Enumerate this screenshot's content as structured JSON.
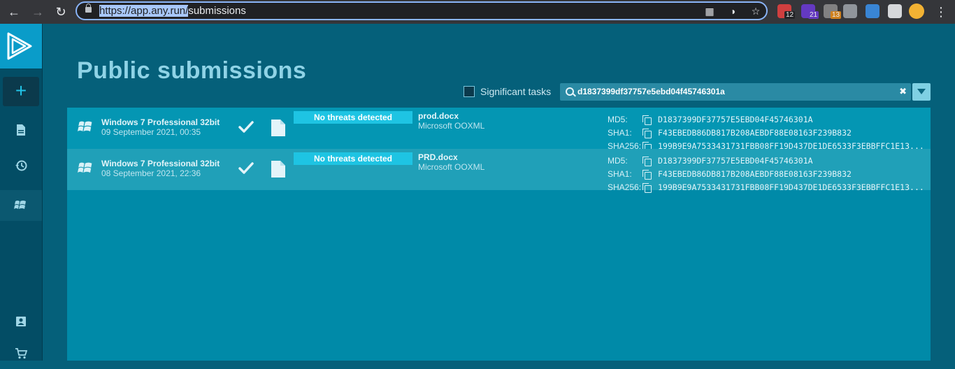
{
  "browser": {
    "url_selected": "https://app.any.run/",
    "url_rest": "submissions",
    "extensions": [
      {
        "name": "ext-red-icon",
        "badge": "12",
        "color": "#e04040",
        "badge_color": "#202124"
      },
      {
        "name": "ext-cap-icon",
        "badge": "21",
        "color": "#6a3ad0",
        "badge_color": "#6a3ad0"
      },
      {
        "name": "ext-grey-icon",
        "badge": "13",
        "color": "#8a8a8a",
        "badge_color": "#e08a1c"
      },
      {
        "name": "ext-feather-icon",
        "badge": "",
        "color": "#9aa0a6",
        "badge_color": ""
      },
      {
        "name": "ext-pin-icon",
        "badge": "",
        "color": "#3a8ee6",
        "badge_color": ""
      },
      {
        "name": "ext-puzzle-icon",
        "badge": "",
        "color": "#e8eaed",
        "badge_color": ""
      }
    ]
  },
  "page": {
    "title": "Public submissions",
    "significant_label": "Significant tasks",
    "search_value": "d1837399df37757e5ebd04f45746301a"
  },
  "tasks": [
    {
      "os": "Windows 7 Professional 32bit",
      "date": "09 September 2021, 00:35",
      "verdict": "No threats detected",
      "file_name": "prod.docx",
      "file_type": "Microsoft OOXML",
      "md5_label": "MD5:",
      "md5": "D1837399DF37757E5EBD04F45746301A",
      "sha1_label": "SHA1:",
      "sha1": "F43EBEDB86DB817B208AEBDF88E08163F239B832",
      "sha256_label": "SHA256:",
      "sha256": "199B9E9A7533431731FBB08FF19D437DE1DE6533F3EBBFFC1E13..."
    },
    {
      "os": "Windows 7 Professional 32bit",
      "date": "08 September 2021, 22:36",
      "verdict": "No threats detected",
      "file_name": "PRD.docx",
      "file_type": "Microsoft OOXML",
      "md5_label": "MD5:",
      "md5": "D1837399DF37757E5EBD04F45746301A",
      "sha1_label": "SHA1:",
      "sha1": "F43EBEDB86DB817B208AEBDF88E08163F239B832",
      "sha256_label": "SHA256:",
      "sha256": "199B9E9A7533431731FBB08FF19D437DE1DE6533F3EBBFFC1E13..."
    }
  ],
  "colors": {
    "accent": "#0a9cc9",
    "verdict_bg": "#1ec4e3",
    "panel": "#008aa8"
  }
}
